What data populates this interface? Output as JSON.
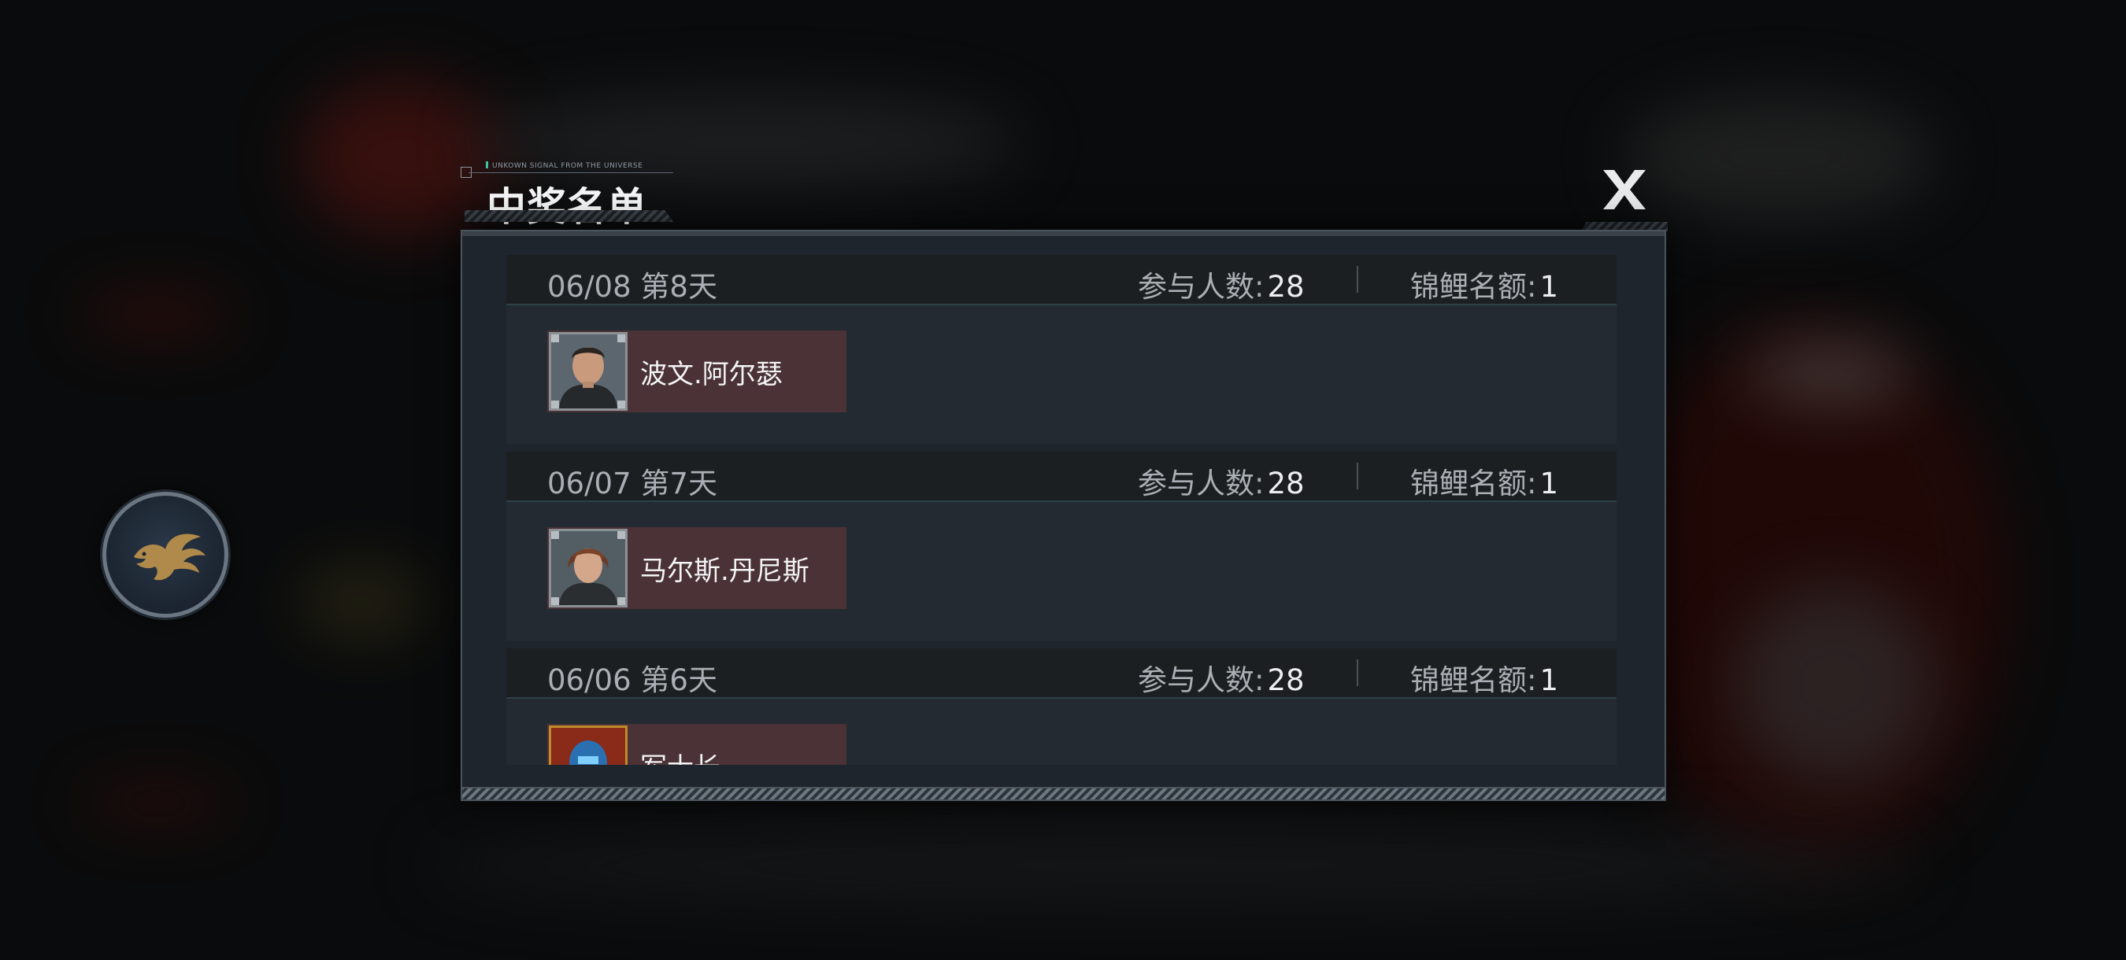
{
  "dialog": {
    "subtitle": "UNKOWN SIGNAL FROM THE UNIVERSE",
    "title": "中奖名单",
    "close_label": "X"
  },
  "days": [
    {
      "date": "06/08",
      "day_label": "第8天",
      "participants_label": "参与人数:",
      "participants": "28",
      "quota_label": "锦鲤名额:",
      "quota": "1",
      "winner": "波文.阿尔瑟",
      "avatar_icon": "male-officer-portrait"
    },
    {
      "date": "06/07",
      "day_label": "第7天",
      "participants_label": "参与人数:",
      "participants": "28",
      "quota_label": "锦鲤名额:",
      "quota": "1",
      "winner": "马尔斯.丹尼斯",
      "avatar_icon": "female-officer-portrait"
    },
    {
      "date": "06/06",
      "day_label": "第6天",
      "participants_label": "参与人数:",
      "participants": "28",
      "quota_label": "锦鲤名额:",
      "quota": "1",
      "winner": "军士长",
      "avatar_icon": "armored-soldier-portrait"
    }
  ],
  "colors": {
    "panel_bg": "#1f252c",
    "row_header_bg": "#1c1f22",
    "winner_bg": "#4a3236",
    "accent": "#3fc2a0"
  }
}
